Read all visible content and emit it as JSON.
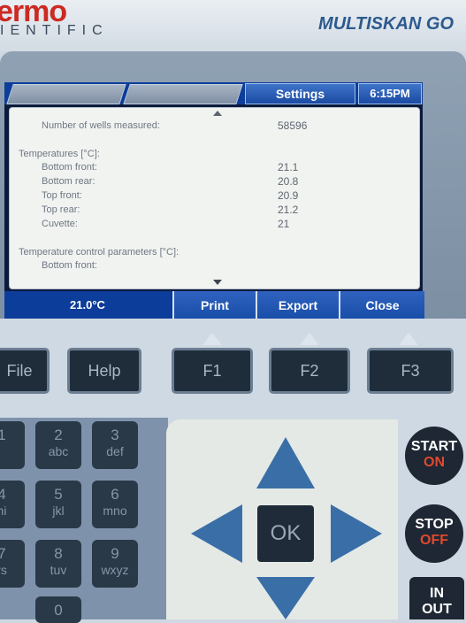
{
  "header": {
    "brand_top": "ermo",
    "brand_bottom": "IENTIFIC",
    "model": "MULTISKAN GO"
  },
  "screen": {
    "active_tab": "Settings",
    "clock": "6:15PM",
    "rows": [
      {
        "label": "Number of wells measured:",
        "value": "58596"
      },
      {
        "label": "Temperatures [°C]:",
        "value": ""
      },
      {
        "label": "Bottom front:",
        "value": "21.1"
      },
      {
        "label": "Bottom rear:",
        "value": "20.8"
      },
      {
        "label": "Top front:",
        "value": "20.9"
      },
      {
        "label": "Top rear:",
        "value": "21.2"
      },
      {
        "label": "Cuvette:",
        "value": "21"
      },
      {
        "label": "Temperature control parameters [°C]:",
        "value": ""
      },
      {
        "label": "Bottom front:",
        "value": ""
      }
    ],
    "status_temp": "21.0°C",
    "buttons": {
      "print": "Print",
      "export": "Export",
      "close": "Close"
    }
  },
  "keys": {
    "file": "File",
    "help": "Help",
    "f1": "F1",
    "f2": "F2",
    "f3": "F3",
    "num2": {
      "digit": "2",
      "letters": "abc"
    },
    "num3": {
      "digit": "3",
      "letters": "def"
    },
    "num5": {
      "digit": "5",
      "letters": "jkl"
    },
    "num6": {
      "digit": "6",
      "letters": "mno"
    },
    "num8": {
      "digit": "8",
      "letters": "tuv"
    },
    "num9": {
      "digit": "9",
      "letters": "wxyz"
    },
    "num0": {
      "digit": "0",
      "letters": ""
    },
    "partial_left": {
      "k1": "1",
      "k4": "4",
      "k4l": "hi",
      "k7": "7",
      "k7l": "rs"
    },
    "ok": "OK",
    "start": {
      "top": "START",
      "bottom": "ON"
    },
    "stop": {
      "top": "STOP",
      "bottom": "OFF"
    },
    "inout": {
      "top": "IN",
      "bottom": "OUT"
    }
  },
  "colors": {
    "screen_blue": "#0d3d9a",
    "brand_red": "#cc2a22",
    "model_blue": "#2d5a8e",
    "accent_red": "#e0492e"
  }
}
